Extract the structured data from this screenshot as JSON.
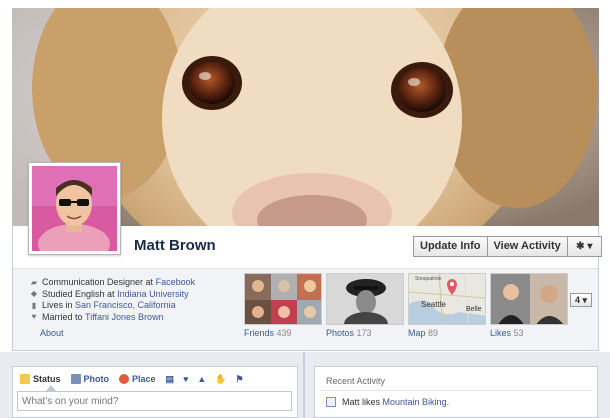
{
  "profile": {
    "name": "Matt Brown"
  },
  "actions": {
    "update_info": "Update Info",
    "view_activity": "View Activity",
    "gear": "✱ ▾"
  },
  "info": {
    "items": [
      {
        "icon": "briefcase-icon",
        "glyph": "▰",
        "prefix": "Communication Designer at ",
        "link": "Facebook"
      },
      {
        "icon": "graduation-cap-icon",
        "glyph": "◆",
        "prefix": "Studied English at ",
        "link": "Indiana University"
      },
      {
        "icon": "house-icon",
        "glyph": "▮",
        "prefix": "Lives in ",
        "link": "San Francisco, California"
      },
      {
        "icon": "heart-icon",
        "glyph": "♥",
        "prefix": "Married to ",
        "link": "Tiffani Jones Brown"
      }
    ],
    "about_label": "About"
  },
  "tiles": {
    "friends": {
      "label": "Friends",
      "count": "439"
    },
    "photos": {
      "label": "Photos",
      "count": "173"
    },
    "map": {
      "label": "Map",
      "count": "89",
      "city_label": "Seattle",
      "city_label2": "Belle",
      "top_label": "Snoqualmie"
    },
    "likes": {
      "label": "Likes",
      "count": "53"
    },
    "more": "4 ▾"
  },
  "composer": {
    "tabs": [
      {
        "label": "Status",
        "icon": "status-icon",
        "color": "#f2c94c"
      },
      {
        "label": "Photo",
        "icon": "photo-icon",
        "color": "#7a8fb5"
      },
      {
        "label": "Place",
        "icon": "place-icon",
        "color": "#e05a3c"
      }
    ],
    "mini_icons": [
      "▤",
      "♥",
      "▲",
      "✋",
      "⚑"
    ],
    "placeholder": "What's on your mind?"
  },
  "activity": {
    "title": "Recent Activity",
    "item_prefix": "Matt likes ",
    "item_link": "Mountain Biking."
  },
  "colors": {
    "link": "#3b5998",
    "name": "#1c2a47",
    "timeline_bg": "#e9ebf1"
  }
}
